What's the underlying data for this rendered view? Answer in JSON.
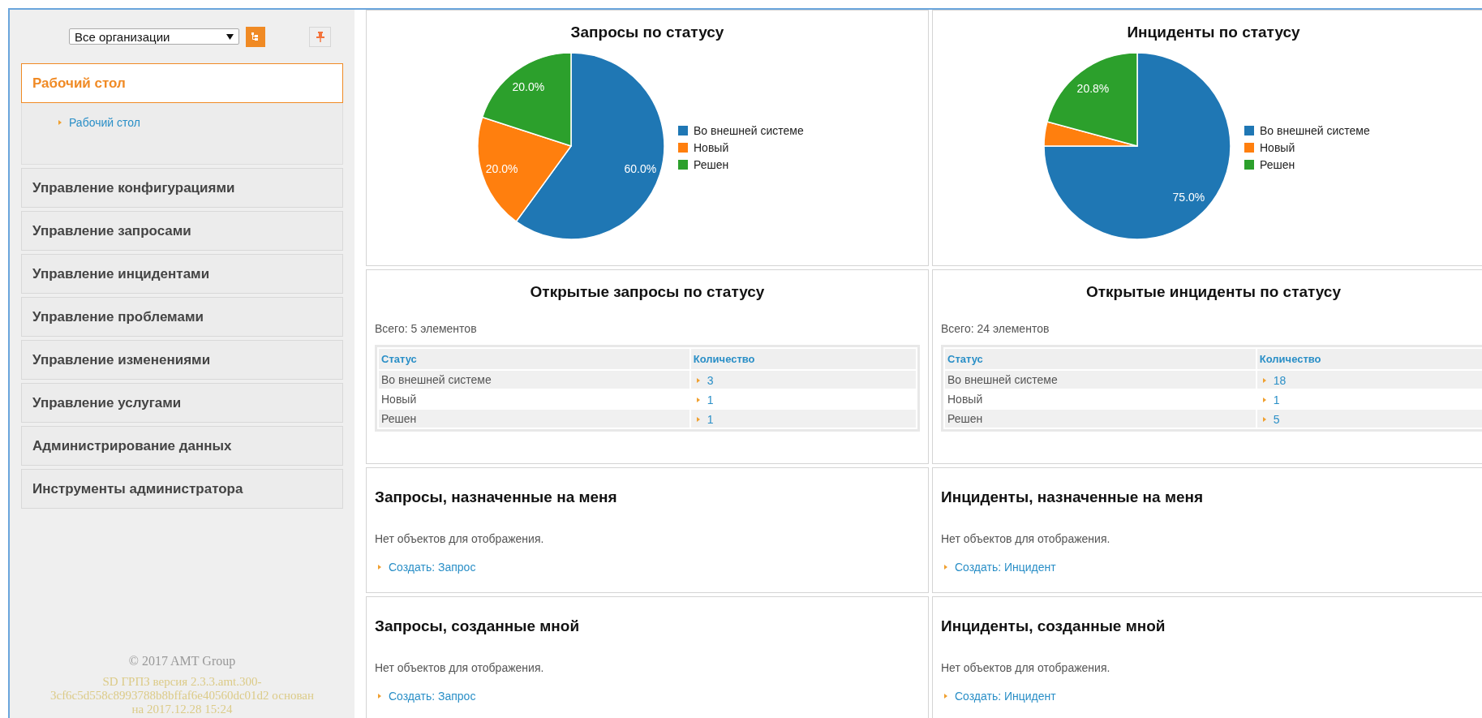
{
  "sidebar": {
    "org_select": {
      "value": "Все организации"
    },
    "sections": [
      {
        "label": "Рабочий стол",
        "expanded": true,
        "children": [
          {
            "label": "Рабочий стол"
          }
        ]
      },
      {
        "label": "Управление конфигурациями",
        "expanded": false
      },
      {
        "label": "Управление запросами",
        "expanded": false
      },
      {
        "label": "Управление инцидентами",
        "expanded": false
      },
      {
        "label": "Управление проблемами",
        "expanded": false
      },
      {
        "label": "Управление изменениями",
        "expanded": false
      },
      {
        "label": "Управление услугами",
        "expanded": false
      },
      {
        "label": "Администрирование данных",
        "expanded": false
      },
      {
        "label": "Инструменты администратора",
        "expanded": false
      }
    ],
    "footer": {
      "copyright": "© 2017 AMT Group",
      "version_lines": [
        "SD ГРПЗ версия 2.3.3.amt.300-",
        "3cf6c5d558c8993788b8bffaf6e40560dc01d2 основан",
        "на 2017.12.28 15:24"
      ]
    }
  },
  "panels": [
    {
      "kind": "chart",
      "title": "Запросы по статусу",
      "chart_data": {
        "type": "pie",
        "categories": [
          "Во внешней системе",
          "Новый",
          "Решен"
        ],
        "values": [
          60,
          20,
          20
        ],
        "legend": "right",
        "colors": [
          "#1f77b4",
          "#ff7f0e",
          "#2ca02c"
        ],
        "value_labels": [
          "60.0%",
          "20.0%",
          "20.0%"
        ]
      }
    },
    {
      "kind": "chart",
      "title": "Инциденты по статусу",
      "chart_data": {
        "type": "pie",
        "categories": [
          "Во внешней системе",
          "Новый",
          "Решен"
        ],
        "values": [
          75,
          4.2,
          20.8
        ],
        "legend": "right",
        "colors": [
          "#1f77b4",
          "#ff7f0e",
          "#2ca02c"
        ],
        "value_labels": [
          "75.0%",
          null,
          "20.8%"
        ]
      }
    },
    {
      "kind": "table",
      "title": "Открытые запросы по статусу",
      "total": "Всего: 5 элементов",
      "columns": [
        "Статус",
        "Количество"
      ],
      "rows": [
        {
          "status": "Во внешней системе",
          "count": "3"
        },
        {
          "status": "Новый",
          "count": "1"
        },
        {
          "status": "Решен",
          "count": "1"
        }
      ]
    },
    {
      "kind": "table",
      "title": "Открытые инциденты по статусу",
      "total": "Всего: 24 элементов",
      "columns": [
        "Статус",
        "Количество"
      ],
      "rows": [
        {
          "status": "Во внешней системе",
          "count": "18"
        },
        {
          "status": "Новый",
          "count": "1"
        },
        {
          "status": "Решен",
          "count": "5"
        }
      ]
    },
    {
      "kind": "list",
      "title": "Запросы, назначенные на меня",
      "empty": "Нет объектов для отображения.",
      "create_link": "Создать: Запрос"
    },
    {
      "kind": "list",
      "title": "Инциденты, назначенные на меня",
      "empty": "Нет объектов для отображения.",
      "create_link": "Создать: Инцидент"
    },
    {
      "kind": "list",
      "title": "Запросы, созданные мной",
      "empty": "Нет объектов для отображения.",
      "create_link": "Создать: Запрос"
    },
    {
      "kind": "list",
      "title": "Инциденты, созданные мной",
      "empty": "Нет объектов для отображения.",
      "create_link": "Создать: Инцидент"
    }
  ]
}
